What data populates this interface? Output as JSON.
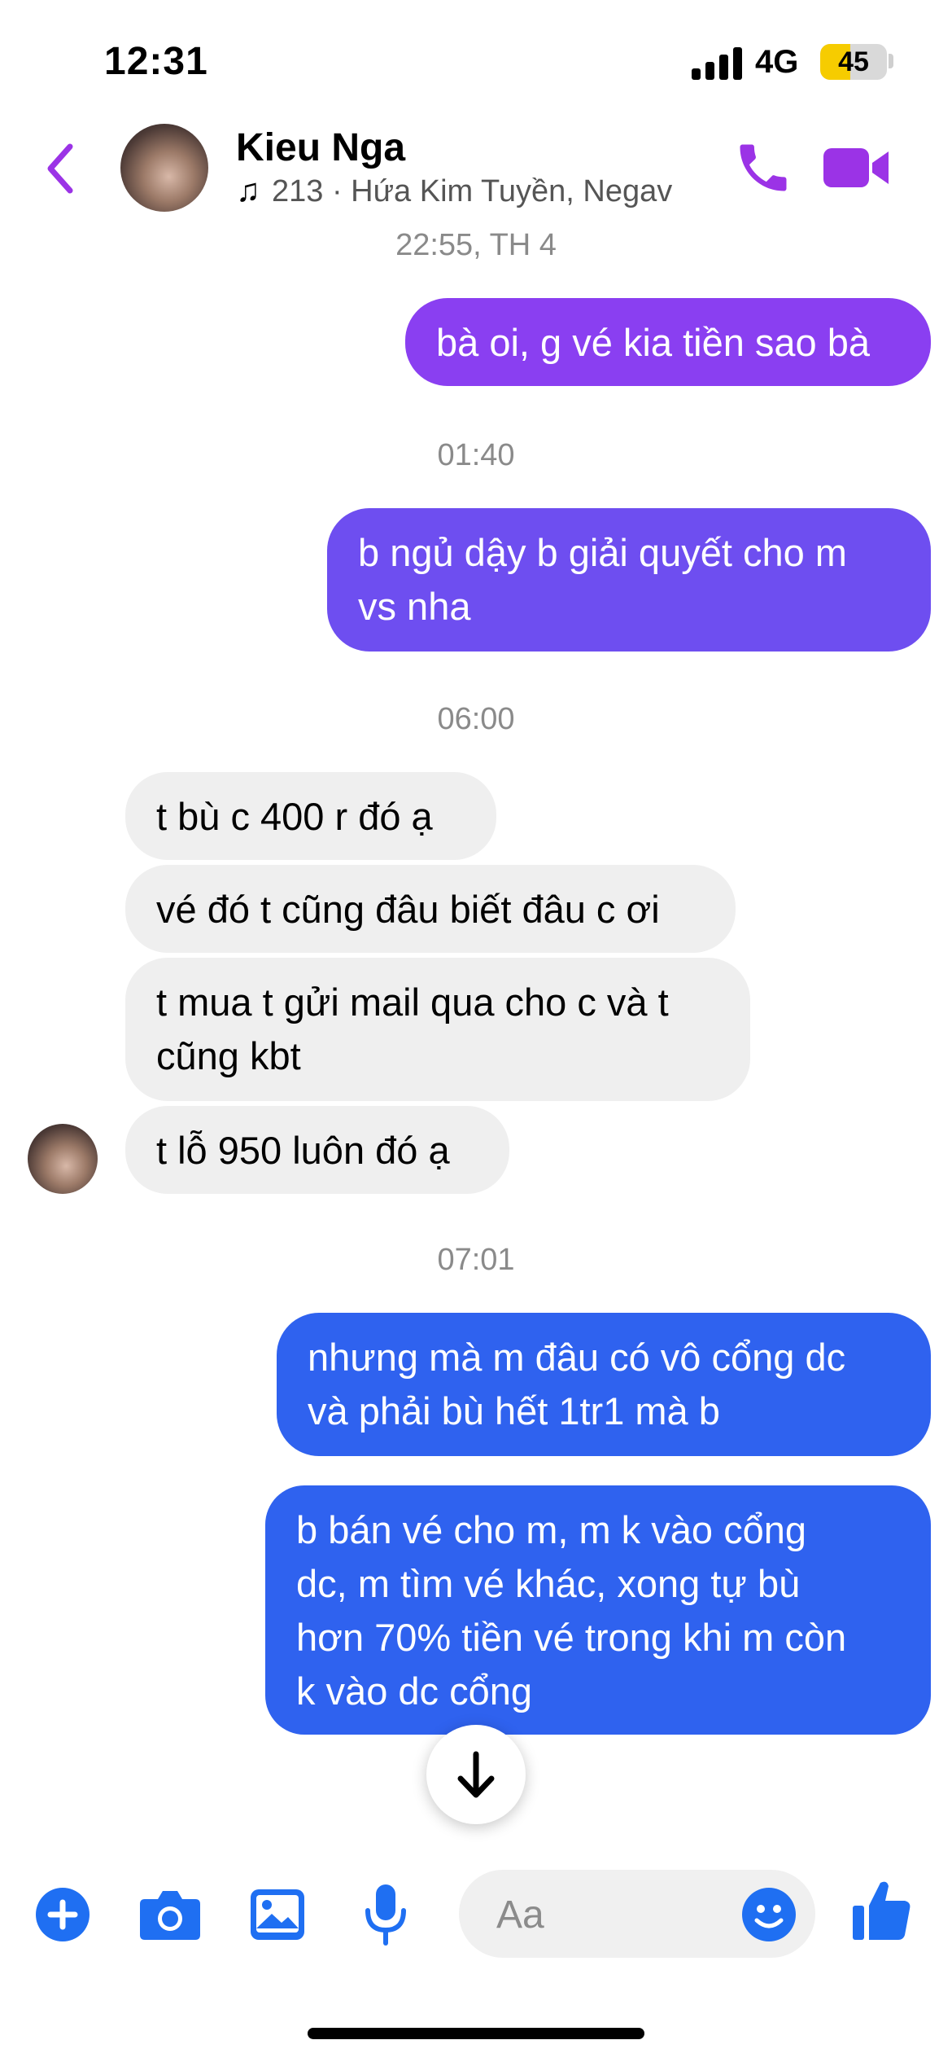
{
  "status_bar": {
    "time": "12:31",
    "network": "4G",
    "battery": "45",
    "battery_level_percent": 45,
    "battery_color": "#f6cc00"
  },
  "header": {
    "name": "Kieu Nga",
    "now_playing": "213 · Hứa Kim Tuyền, Negav",
    "accent_color": "#9b33e6",
    "icons": [
      "back-chevron-icon",
      "music-note-icon",
      "phone-icon",
      "video-camera-icon"
    ]
  },
  "messages": {
    "ts1": "22:55, TH 4",
    "m1": "bà oi, g vé kia tiền sao bà",
    "ts2": "01:40",
    "m2_l1": "b ngủ dậy b giải quyết cho m",
    "m2_l2": "vs nha",
    "ts3": "06:00",
    "m3": "t bù c 400 r đó ạ",
    "m4": "vé đó t cũng đâu biết đâu c ơi",
    "m5_l1": "t mua t gửi mail qua cho c và t",
    "m5_l2": "cũng kbt",
    "m6": "t lỗ 950 luôn đó ạ",
    "ts4": "07:01",
    "m7_l1": "nhưng mà m đâu có vô cổng dc",
    "m7_l2": "và phải bù hết 1tr1 mà b",
    "m8_l1": "b bán vé cho m, m k vào cổng",
    "m8_l2": "dc, m tìm vé khác, xong tự bù",
    "m8_l3": "hơn 70% tiền vé trong khi m còn",
    "m8_l4": "k vào dc cổng"
  },
  "colors": {
    "outgoing_purple": "#8a3ff1",
    "outgoing_violet": "#6e4ef0",
    "outgoing_blue": "#2f62ef",
    "incoming_gray": "#efefef",
    "composer_icon_blue": "#1f6ff2"
  },
  "composer": {
    "placeholder": "Aa",
    "icons": [
      "plus-icon",
      "camera-icon",
      "image-icon",
      "microphone-icon",
      "emoji-icon",
      "thumbs-up-icon"
    ]
  },
  "scroll_button_icon": "arrow-down-icon"
}
